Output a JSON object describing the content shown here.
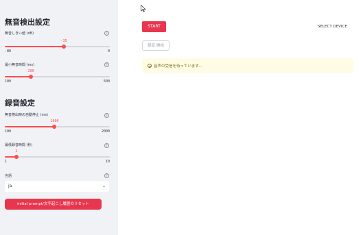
{
  "sidebar": {
    "silence_section_title": "無音検出設定",
    "threshold": {
      "label": "無音しきい値 (dB)",
      "value": "-35",
      "min": "-80",
      "max": "0",
      "fraction": 0.5625
    },
    "min_silence": {
      "label": "最小無音時間 (ms)",
      "value": "200",
      "min": "100",
      "max": "500",
      "fraction": 0.25
    },
    "record_section_title": "録音設定",
    "auto_stop": {
      "label": "無音検出時の自動停止 (ms)",
      "value": "1000",
      "min": "100",
      "max": "2000",
      "fraction": 0.4737
    },
    "min_record": {
      "label": "最低録音時間 (秒)",
      "value": "2",
      "min": "1",
      "max": "10",
      "fraction": 0.1111
    },
    "language": {
      "label": "言語",
      "selected": "ja"
    },
    "reset_button": "initial prompt/文字起こし履歴のリセット",
    "help_glyph": "?"
  },
  "main": {
    "start_button": "START",
    "select_device": "SELECT DEVICE",
    "record_button": "録音 開始",
    "status_text": "音声の受信を待っています..."
  },
  "icons": {
    "help": "question-circle-icon",
    "chevron": "chevron-down-icon",
    "spinner": "spinner-icon",
    "cursor": "mouse-cursor-icon"
  },
  "colors": {
    "accent": "#ff4b4b",
    "button": "#e8364e",
    "sidebar_bg": "#f0f2f6",
    "status_bg": "#fffce6"
  }
}
